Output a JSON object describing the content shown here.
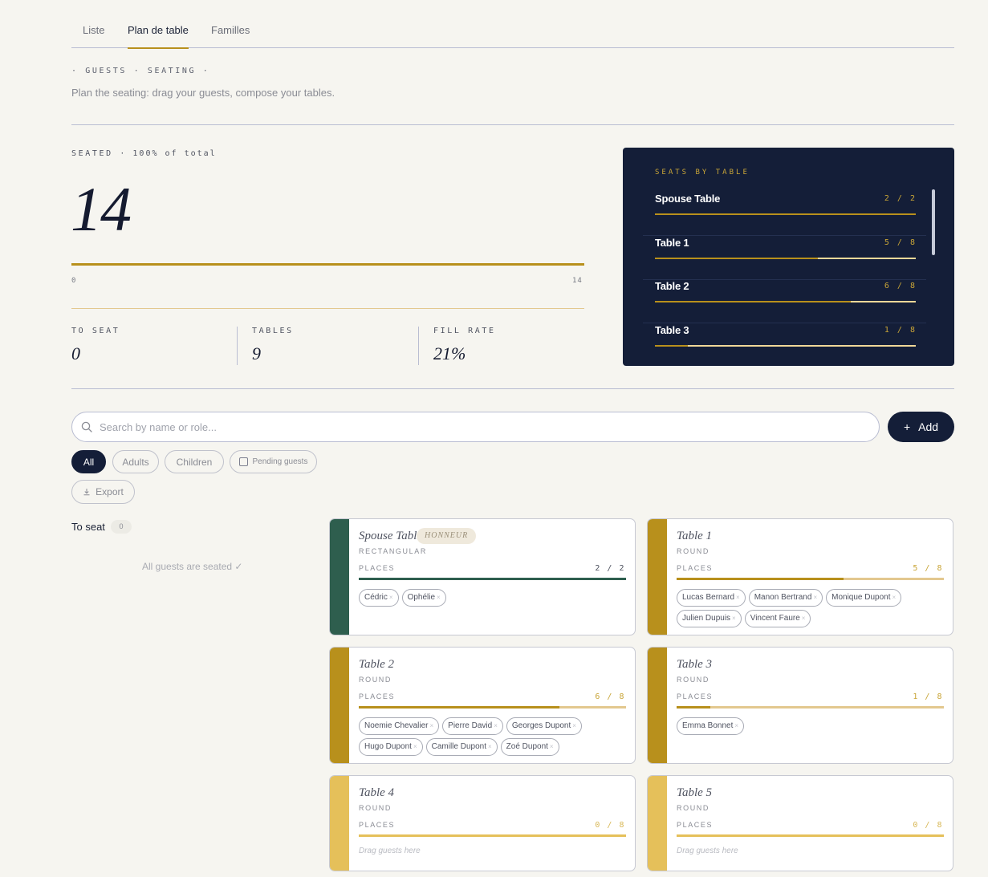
{
  "tabs": [
    "Liste",
    "Plan de table",
    "Familles"
  ],
  "active_tab": 1,
  "eyebrow": "· GUESTS · SEATING ·",
  "subtitle": "Plan the seating: drag your guests, compose your tables.",
  "seated": {
    "label": "SEATED",
    "pct_text": "· 100% of total",
    "count": "14",
    "scale_min": "0",
    "scale_max": "14",
    "fill_fraction": 1.0
  },
  "stats": [
    {
      "label": "TO SEAT",
      "value": "0"
    },
    {
      "label": "TABLES",
      "value": "9"
    },
    {
      "label": "FILL RATE",
      "value": "21%"
    }
  ],
  "panel": {
    "title": "SEATS BY TABLE",
    "rows": [
      {
        "name": "Spouse Table",
        "count": "2 / 2",
        "fraction": 1.0
      },
      {
        "name": "Table 1",
        "count": "5 / 8",
        "fraction": 0.625
      },
      {
        "name": "Table 2",
        "count": "6 / 8",
        "fraction": 0.75
      },
      {
        "name": "Table 3",
        "count": "1 / 8",
        "fraction": 0.125
      }
    ]
  },
  "search": {
    "placeholder": "Search by name or role..."
  },
  "add_label": "Add",
  "filters": [
    "All",
    "Adults",
    "Children"
  ],
  "pending_label": "Pending guests",
  "export_label": "Export",
  "to_seat": {
    "title": "To seat",
    "count": "0",
    "empty_text": "All guests are seated ✓"
  },
  "cards": [
    {
      "name": "Spouse Table",
      "badge": "HONNEUR",
      "shape": "RECTANGULAR",
      "places_label": "PLACES",
      "count": "2 / 2",
      "fraction": 1.0,
      "accent": "#2e5e4e",
      "track": "#2e5e4e",
      "count_color": "#4f5360",
      "guests": [
        "Cédric",
        "Ophélie"
      ]
    },
    {
      "name": "Table 1",
      "shape": "ROUND",
      "places_label": "PLACES",
      "count": "5 / 8",
      "fraction": 0.625,
      "accent": "#b8901c",
      "track": "#e3c88f",
      "count_color": "#c9a537",
      "guests": [
        "Lucas Bernard",
        "Manon Bertrand",
        "Monique Dupont",
        "Julien Dupuis",
        "Vincent Faure"
      ]
    },
    {
      "name": "Table 2",
      "shape": "ROUND",
      "places_label": "PLACES",
      "count": "6 / 8",
      "fraction": 0.75,
      "accent": "#b8901c",
      "track": "#e3c88f",
      "count_color": "#c9a537",
      "guests": [
        "Noemie Chevalier",
        "Pierre David",
        "Georges Dupont",
        "Hugo Dupont",
        "Camille Dupont",
        "Zoé Dupont"
      ]
    },
    {
      "name": "Table 3",
      "shape": "ROUND",
      "places_label": "PLACES",
      "count": "1 / 8",
      "fraction": 0.125,
      "accent": "#b8901c",
      "track": "#e3c88f",
      "count_color": "#c9a537",
      "guests": [
        "Emma Bonnet"
      ]
    },
    {
      "name": "Table 4",
      "shape": "ROUND",
      "places_label": "PLACES",
      "count": "0 / 8",
      "fraction": 0.0,
      "accent": "#e5c05a",
      "track": "#e5c05a",
      "count_color": "#d8b857",
      "guests": [],
      "empty_text": "Drag guests here"
    },
    {
      "name": "Table 5",
      "shape": "ROUND",
      "places_label": "PLACES",
      "count": "0 / 8",
      "fraction": 0.0,
      "accent": "#e5c05a",
      "track": "#e5c05a",
      "count_color": "#d8b857",
      "guests": [],
      "empty_text": "Drag guests here"
    }
  ],
  "remove_glyph": "×",
  "icons": {
    "search": "search-icon",
    "plus": "plus-icon",
    "download": "download-icon"
  }
}
